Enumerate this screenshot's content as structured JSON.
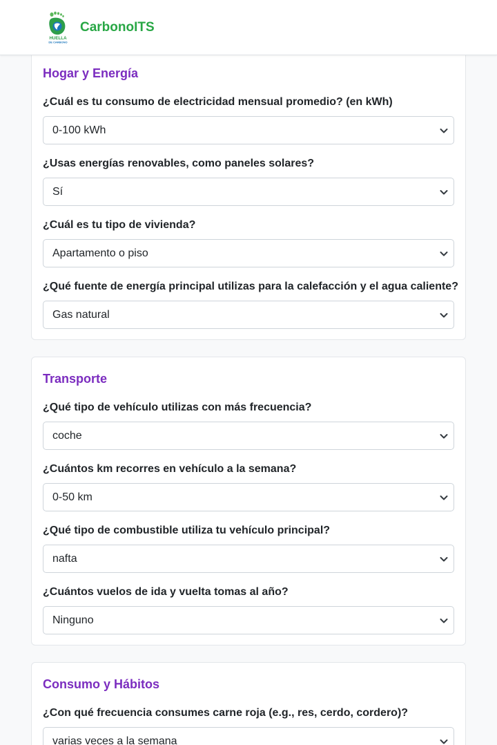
{
  "navbar": {
    "logo_text_line1": "HUELLA",
    "logo_text_line2": "DE CARBONO",
    "brand": "CarbonoITS"
  },
  "sections": [
    {
      "title": "Hogar y Energía",
      "questions": [
        {
          "label": "¿Cuál es tu consumo de electricidad mensual promedio? (en kWh)",
          "value": "0-100 kWh"
        },
        {
          "label": "¿Usas energías renovables, como paneles solares?",
          "value": "Sí"
        },
        {
          "label": "¿Cuál es tu tipo de vivienda?",
          "value": "Apartamento o piso"
        },
        {
          "label": "¿Qué fuente de energía principal utilizas para la calefacción y el agua caliente?",
          "value": "Gas natural"
        }
      ]
    },
    {
      "title": "Transporte",
      "questions": [
        {
          "label": "¿Qué tipo de vehículo utilizas con más frecuencia?",
          "value": "coche"
        },
        {
          "label": "¿Cuántos km recorres en vehículo a la semana?",
          "value": "0-50 km"
        },
        {
          "label": "¿Qué tipo de combustible utiliza tu vehículo principal?",
          "value": "nafta"
        },
        {
          "label": "¿Cuántos vuelos de ida y vuelta tomas al año?",
          "value": "Ninguno"
        }
      ]
    },
    {
      "title": "Consumo y Hábitos",
      "questions": [
        {
          "label": "¿Con qué frecuencia consumes carne roja (e.g., res, cerdo, cordero)?",
          "value": "varias veces a la semana"
        }
      ]
    }
  ],
  "colors": {
    "brand_green": "#28a745",
    "section_title_purple": "#7b2cbf"
  }
}
